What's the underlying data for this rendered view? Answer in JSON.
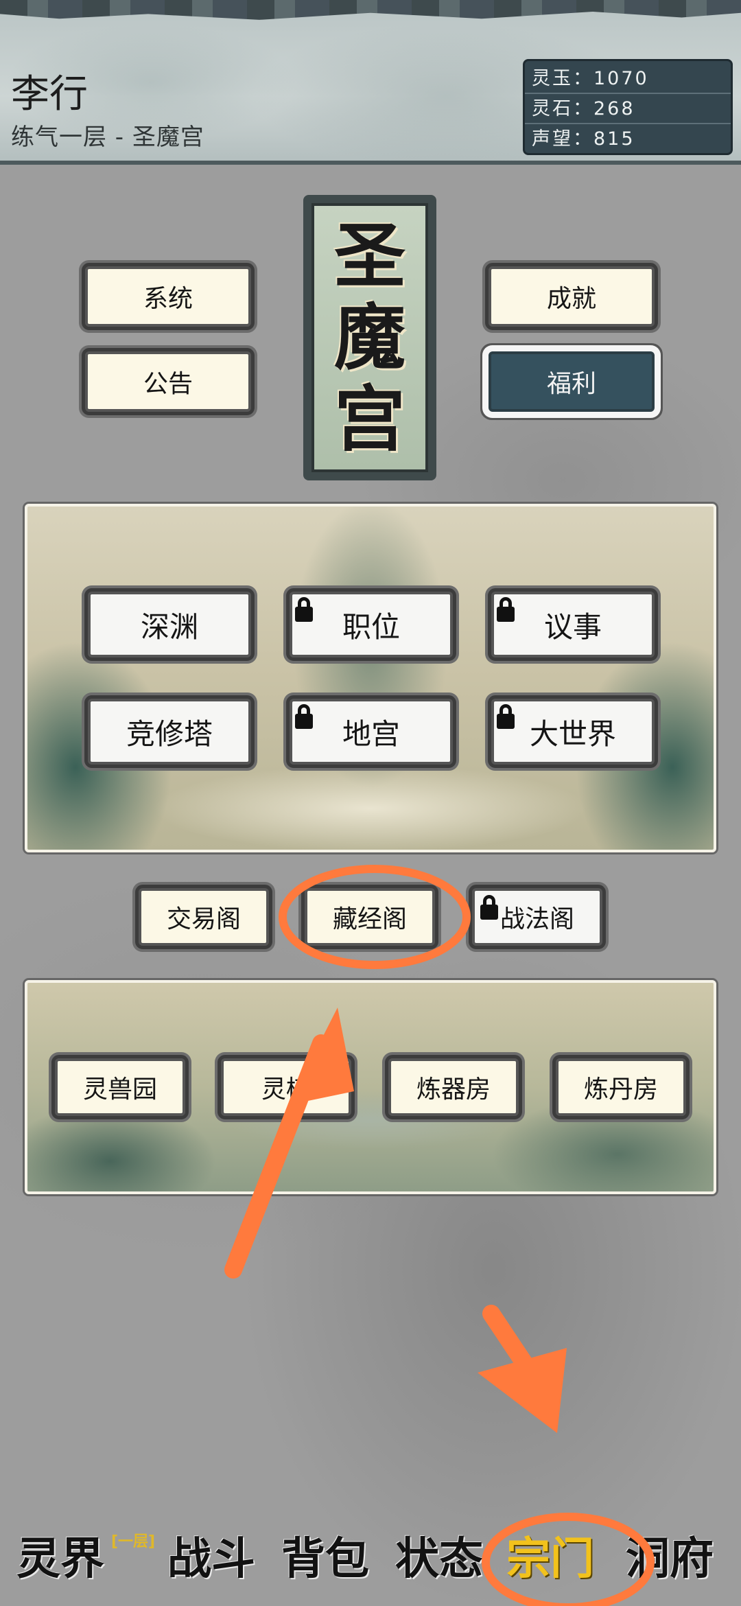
{
  "player": {
    "name": "李行",
    "subtitle": "练气一层 - 圣魔宫"
  },
  "resources": [
    {
      "label": "灵玉：1070"
    },
    {
      "label": "灵石：268"
    },
    {
      "label": "声望：815"
    }
  ],
  "top_buttons": {
    "system": "系统",
    "notice": "公告",
    "achievement": "成就",
    "welfare": "福利"
  },
  "sect_title": [
    "圣",
    "魔",
    "宫"
  ],
  "panel1_buttons": {
    "abyss": "深渊",
    "position": "职位",
    "council": "议事",
    "tower": "竞修塔",
    "underground": "地宫",
    "world": "大世界"
  },
  "middle_buttons": {
    "trade": "交易阁",
    "library": "藏经阁",
    "tactics": "战法阁"
  },
  "panel2_buttons": {
    "beast_garden": "灵兽园",
    "field": "灵植",
    "forge": "炼器房",
    "alchemy": "炼丹房"
  },
  "bottom_nav": {
    "items": [
      "灵界",
      "战斗",
      "背包",
      "状态",
      "宗门",
      "洞府"
    ],
    "badge": "[一层]",
    "active": "宗门"
  },
  "colors": {
    "annotation": "#ff7a3d",
    "active_nav": "#f2c21c",
    "dark_button": "#35515e"
  }
}
